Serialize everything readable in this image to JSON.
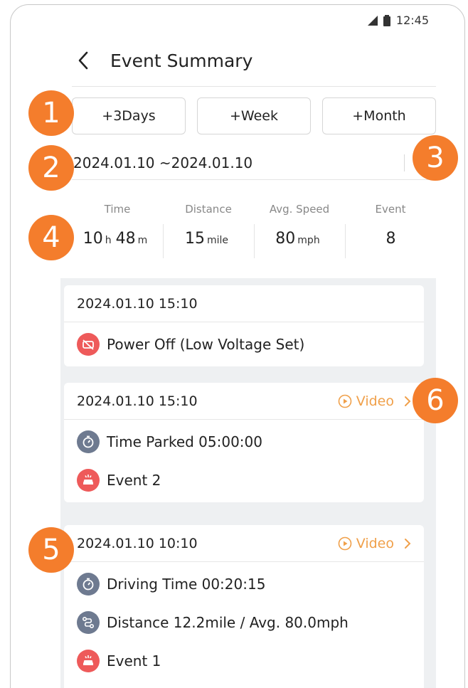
{
  "status": {
    "time": "12:45",
    "icons": [
      "signal-icon",
      "battery-icon"
    ]
  },
  "header": {
    "title": "Event Summary",
    "back_icon": "chevron-left-icon"
  },
  "range_buttons": [
    "+3Days",
    "+Week",
    "+Month"
  ],
  "date_range": {
    "text": "2024.01.10 ~2024.01.10",
    "icon": "calendar-icon"
  },
  "stats": {
    "time": {
      "label": "Time",
      "hours": "10",
      "h_unit": "h",
      "minutes": "48",
      "m_unit": "m"
    },
    "distance": {
      "label": "Distance",
      "value": "15",
      "unit": "mile"
    },
    "speed": {
      "label": "Avg. Speed",
      "value": "80",
      "unit": "mph"
    },
    "event": {
      "label": "Event",
      "value": "8"
    }
  },
  "events": [
    {
      "datetime": "2024.01.10 15:10",
      "rows": [
        {
          "icon": "power-off-icon",
          "text": "Power Off (Low Voltage Set)"
        }
      ]
    },
    {
      "datetime": "2024.01.10 15:10",
      "video_label": "Video",
      "rows": [
        {
          "icon": "stopwatch-icon",
          "text": "Time Parked  05:00:00"
        },
        {
          "icon": "car-crash-icon",
          "text": "Event  2"
        }
      ]
    },
    {
      "datetime": "2024.01.10 10:10",
      "video_label": "Video",
      "rows": [
        {
          "icon": "stopwatch-icon",
          "text": "Driving Time  00:20:15"
        },
        {
          "icon": "route-icon",
          "text": "Distance  12.2mile / Avg.  80.0mph"
        },
        {
          "icon": "car-crash-icon",
          "text": "Event  1"
        }
      ]
    }
  ],
  "callouts": [
    "1",
    "2",
    "3",
    "4",
    "5",
    "6"
  ],
  "colors": {
    "accent_orange": "#f47d2c",
    "video_orange": "#f0a04a",
    "alert_red": "#ee5a5a",
    "slate": "#6e7a90",
    "list_bg": "#eef0f2"
  }
}
